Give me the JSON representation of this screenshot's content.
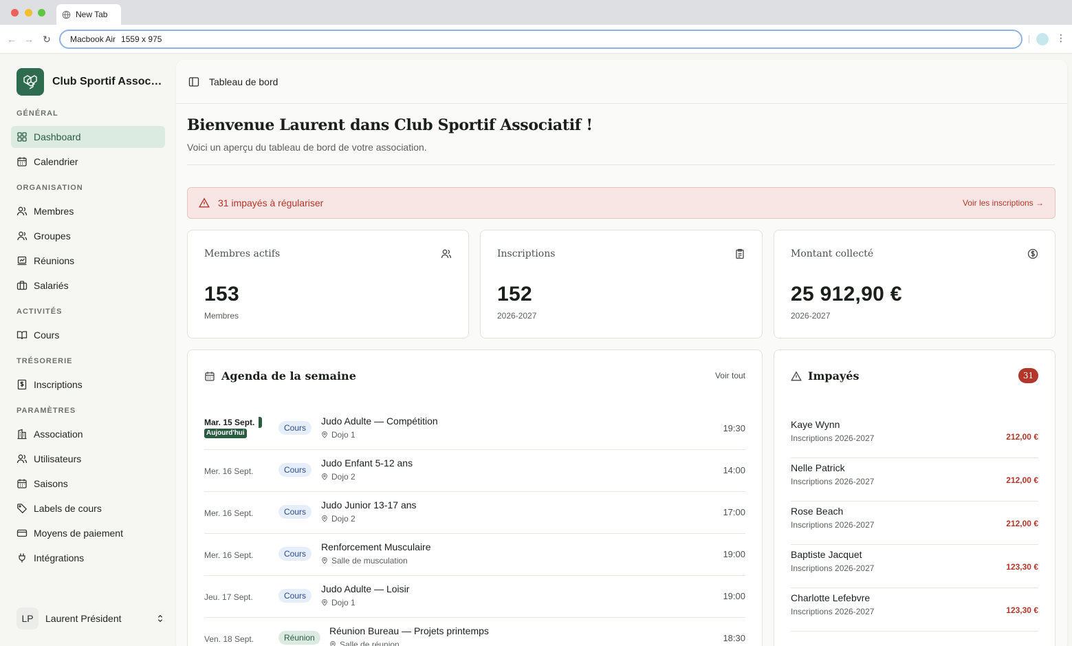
{
  "browser": {
    "tab_title": "New Tab",
    "address": "Macbook Air",
    "address_size": "1559 x 975"
  },
  "sidebar": {
    "brand": "Club Sportif Associatif",
    "sections": {
      "general": "GÉNÉRAL",
      "organisation": "ORGANISATION",
      "activites": "ACTIVITÉS",
      "tresorerie": "TRÉSORERIE",
      "parametres": "PARAMÈTRES"
    },
    "items": {
      "dashboard": "Dashboard",
      "calendrier": "Calendrier",
      "membres": "Membres",
      "groupes": "Groupes",
      "reunions": "Réunions",
      "salaries": "Salariés",
      "cours": "Cours",
      "inscriptions": "Inscriptions",
      "association": "Association",
      "utilisateurs": "Utilisateurs",
      "saisons": "Saisons",
      "labels": "Labels de cours",
      "moyens": "Moyens de paiement",
      "integrations": "Intégrations"
    },
    "user": {
      "initials": "LP",
      "name": "Laurent Président"
    }
  },
  "header": {
    "breadcrumb": "Tableau de bord"
  },
  "welcome": {
    "title": "Bienvenue Laurent dans Club Sportif Associatif !",
    "subtitle": "Voici un aperçu du tableau de bord de votre association."
  },
  "alert": {
    "text": "31 impayés à régulariser",
    "link": "Voir les inscriptions →"
  },
  "stats": [
    {
      "label": "Membres actifs",
      "value": "153",
      "sub": "Membres",
      "icon": "users-icon"
    },
    {
      "label": "Inscriptions",
      "value": "152",
      "sub": "2026-2027",
      "icon": "clipboard-icon"
    },
    {
      "label": "Montant collecté",
      "value": "25 912,90 €",
      "sub": "2026-2027",
      "icon": "dollar-circle-icon"
    }
  ],
  "agenda": {
    "title": "Agenda de la semaine",
    "see_all": "Voir tout",
    "today_label": "Aujourd'hui",
    "rows": [
      {
        "date": "Mar. 15 Sept.",
        "type": "Cours",
        "title": "Judo Adulte — Compétition",
        "location": "Dojo 1",
        "time": "19:30"
      },
      {
        "date": "Mer. 16 Sept.",
        "type": "Cours",
        "title": "Judo Enfant 5-12 ans",
        "location": "Dojo 2",
        "time": "14:00"
      },
      {
        "date": "Mer. 16 Sept.",
        "type": "Cours",
        "title": "Judo Junior 13-17 ans",
        "location": "Dojo 2",
        "time": "17:00"
      },
      {
        "date": "Mer. 16 Sept.",
        "type": "Cours",
        "title": "Renforcement Musculaire",
        "location": "Salle de musculation",
        "time": "19:00"
      },
      {
        "date": "Jeu. 17 Sept.",
        "type": "Cours",
        "title": "Judo Adulte — Loisir",
        "location": "Dojo 1",
        "time": "19:00"
      },
      {
        "date": "Ven. 18 Sept.",
        "type": "Réunion",
        "title": "Réunion Bureau — Projets printemps",
        "location": "Salle de réunion",
        "time": "18:30"
      }
    ]
  },
  "impayes": {
    "title": "Impayés",
    "count": "31",
    "rows": [
      {
        "name": "Kaye Wynn",
        "sub": "Inscriptions 2026-2027",
        "amount": "212,00 €"
      },
      {
        "name": "Nelle Patrick",
        "sub": "Inscriptions 2026-2027",
        "amount": "212,00 €"
      },
      {
        "name": "Rose Beach",
        "sub": "Inscriptions 2026-2027",
        "amount": "212,00 €"
      },
      {
        "name": "Baptiste Jacquet",
        "sub": "Inscriptions 2026-2027",
        "amount": "123,30 €"
      },
      {
        "name": "Charlotte Lefebvre",
        "sub": "Inscriptions 2026-2027",
        "amount": "123,30 €"
      }
    ]
  },
  "colors": {
    "brand": "#2f6b4f",
    "active_bg": "#dcebe1",
    "danger": "#b3362b",
    "alert_bg": "#f7e6e3"
  }
}
